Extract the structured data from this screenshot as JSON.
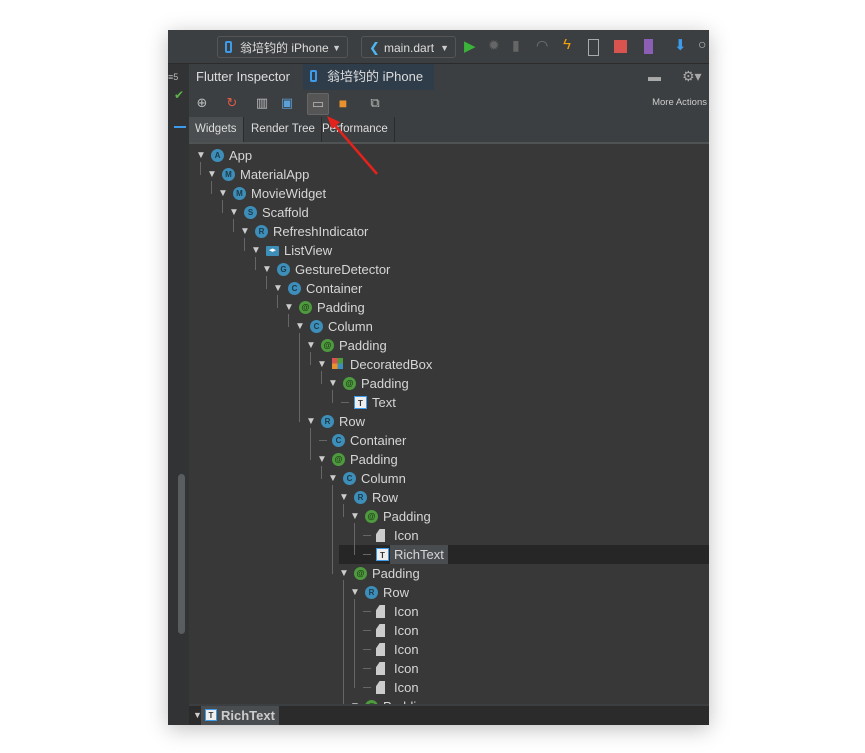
{
  "toolbar": {
    "device": "翁培钧的 iPhone",
    "config": "main.dart"
  },
  "gutter": {
    "badge": "5"
  },
  "tabs": {
    "inspector": "Flutter Inspector",
    "device": "翁培钧的 iPhone"
  },
  "actions": {
    "more": "More Actions"
  },
  "subtabs": [
    "Widgets",
    "Render Tree",
    "Performance"
  ],
  "colors": {
    "blue_node": "#3d8eb9",
    "green_node": "#4e9a3e",
    "selected_bg": "#262626"
  },
  "tree": [
    {
      "label": "App",
      "level": 0,
      "icon": "A",
      "expanded": true
    },
    {
      "label": "MaterialApp",
      "level": 1,
      "icon": "M",
      "expanded": true
    },
    {
      "label": "MovieWidget",
      "level": 2,
      "icon": "M",
      "expanded": true
    },
    {
      "label": "Scaffold",
      "level": 3,
      "icon": "S",
      "expanded": true
    },
    {
      "label": "RefreshIndicator",
      "level": 4,
      "icon": "R",
      "expanded": true
    },
    {
      "label": "ListView",
      "level": 5,
      "icon": "listview",
      "expanded": true
    },
    {
      "label": "GestureDetector",
      "level": 6,
      "icon": "G",
      "expanded": true
    },
    {
      "label": "Container",
      "level": 7,
      "icon": "C",
      "expanded": true
    },
    {
      "label": "Padding",
      "level": 8,
      "icon": "@",
      "expanded": true
    },
    {
      "label": "Column",
      "level": 9,
      "icon": "C",
      "expanded": true
    },
    {
      "label": "Padding",
      "level": 10,
      "icon": "@",
      "expanded": true
    },
    {
      "label": "DecoratedBox",
      "level": 11,
      "icon": "decoratedbox",
      "expanded": true
    },
    {
      "label": "Padding",
      "level": 12,
      "icon": "@",
      "expanded": true
    },
    {
      "label": "Text",
      "level": 13,
      "icon": "T",
      "expanded": false
    },
    {
      "label": "Row",
      "level": 10,
      "icon": "R",
      "expanded": true
    },
    {
      "label": "Container",
      "level": 11,
      "icon": "C",
      "expanded": false
    },
    {
      "label": "Padding",
      "level": 11,
      "icon": "@",
      "expanded": true
    },
    {
      "label": "Column",
      "level": 12,
      "icon": "C",
      "expanded": true
    },
    {
      "label": "Row",
      "level": 13,
      "icon": "R",
      "expanded": true
    },
    {
      "label": "Padding",
      "level": 14,
      "icon": "@",
      "expanded": true
    },
    {
      "label": "Icon",
      "level": 15,
      "icon": "file",
      "expanded": false
    },
    {
      "label": "RichText",
      "level": 15,
      "icon": "T",
      "expanded": false,
      "selected": true
    },
    {
      "label": "Padding",
      "level": 13,
      "icon": "@",
      "expanded": true
    },
    {
      "label": "Row",
      "level": 14,
      "icon": "R",
      "expanded": true
    },
    {
      "label": "Icon",
      "level": 15,
      "icon": "file",
      "expanded": false
    },
    {
      "label": "Icon",
      "level": 15,
      "icon": "file",
      "expanded": false
    },
    {
      "label": "Icon",
      "level": 15,
      "icon": "file",
      "expanded": false
    },
    {
      "label": "Icon",
      "level": 15,
      "icon": "file",
      "expanded": false
    },
    {
      "label": "Icon",
      "level": 15,
      "icon": "file",
      "expanded": false
    },
    {
      "label": "Padding",
      "level": 14,
      "icon": "@",
      "expanded": true
    }
  ],
  "details": {
    "label": "RichText",
    "icon": "T"
  }
}
